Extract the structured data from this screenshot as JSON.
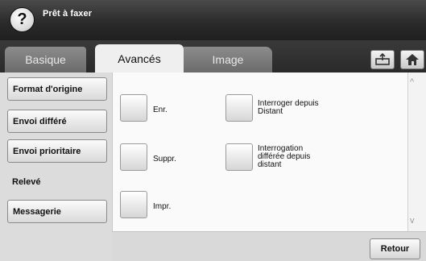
{
  "header": {
    "help_icon": "question-icon",
    "help_glyph": "?",
    "title": "Prêt à faxer"
  },
  "tabs": [
    {
      "label": "Basique",
      "active": false
    },
    {
      "label": "Avancés",
      "active": true
    },
    {
      "label": "Image",
      "active": false
    }
  ],
  "toolbar": {
    "send_icon": "send-tray-icon",
    "home_icon": "home-icon"
  },
  "sidebar": {
    "items": [
      {
        "label": "Format d'origine",
        "active": false
      },
      {
        "label": "Envoi différé",
        "active": false
      },
      {
        "label": "Envoi prioritaire",
        "active": false
      },
      {
        "label": "Relevé",
        "active": true
      },
      {
        "label": "Messagerie",
        "active": false
      }
    ]
  },
  "options": [
    {
      "label": "Enr."
    },
    {
      "label": "Suppr."
    },
    {
      "label": "Impr."
    },
    {
      "label_lines": [
        "Interroger depuis",
        "Distant"
      ]
    },
    {
      "label_lines": [
        "Interrogation",
        "différée depuis",
        "distant"
      ]
    }
  ],
  "scroll": {
    "up_glyph": "^",
    "down_glyph": "v"
  },
  "footer": {
    "back_label": "Retour"
  },
  "colors": {
    "header": "#2b2b2b",
    "active_tab": "#efefef",
    "inactive_tab": "#7a7a7a"
  }
}
